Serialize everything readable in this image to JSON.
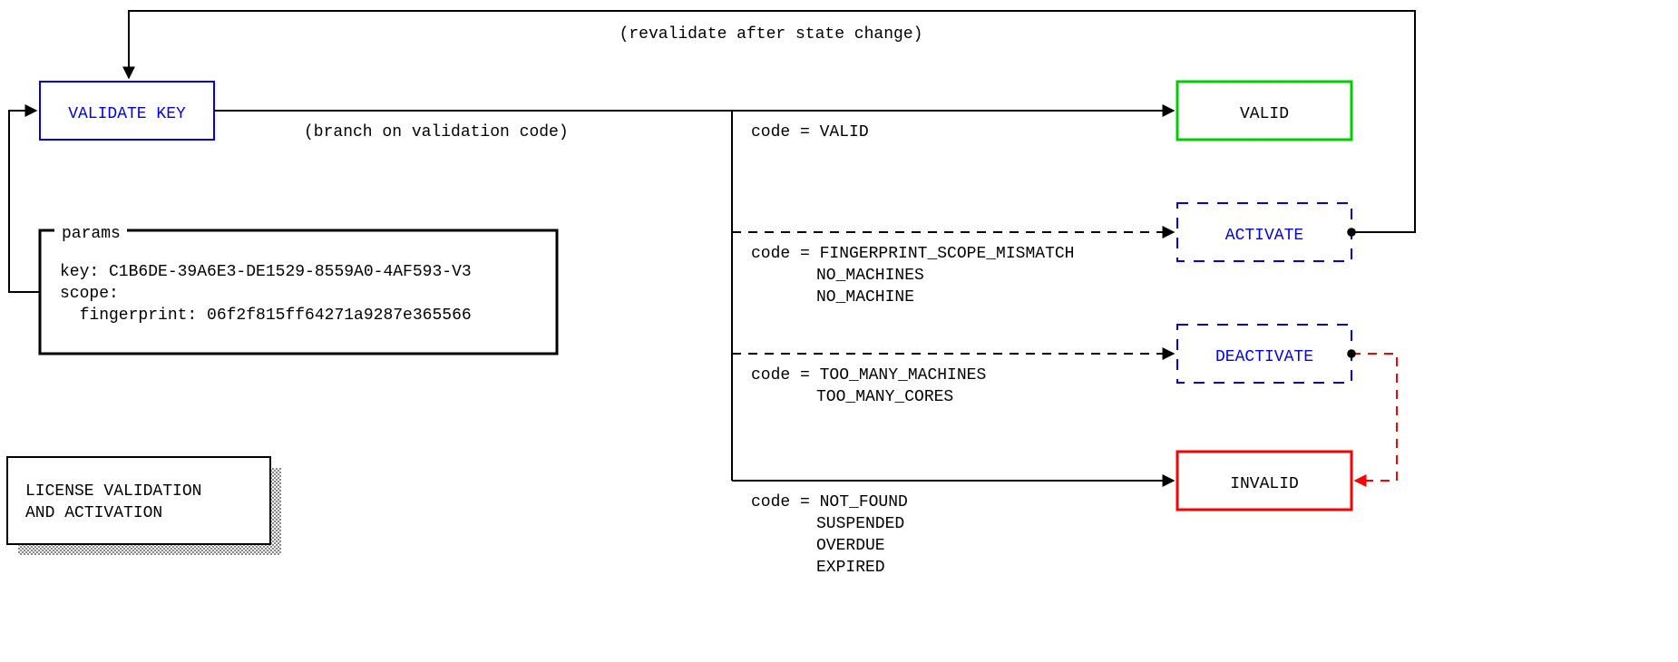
{
  "title": {
    "line1": "LICENSE VALIDATION",
    "line2": "AND ACTIVATION"
  },
  "validate_key": "VALIDATE KEY",
  "params": {
    "legend": "params",
    "key_line": "key: C1B6DE-39A6E3-DE1529-8559A0-4AF593-V3",
    "scope_line": "scope:",
    "fingerprint_line": "  fingerprint: 06f2f815ff64271a9287e365566"
  },
  "edge_labels": {
    "revalidate": "(revalidate after state change)",
    "branch": "(branch on validation code)"
  },
  "branches": {
    "valid": {
      "code_label": "code = VALID",
      "box": "VALID"
    },
    "activate": {
      "code_prefix": "code = ",
      "codes": [
        "FINGERPRINT_SCOPE_MISMATCH",
        "NO_MACHINES",
        "NO_MACHINE"
      ],
      "box": "ACTIVATE"
    },
    "deactivate": {
      "code_prefix": "code = ",
      "codes": [
        "TOO_MANY_MACHINES",
        "TOO_MANY_CORES"
      ],
      "box": "DEACTIVATE"
    },
    "invalid": {
      "code_prefix": "code = ",
      "codes": [
        "NOT_FOUND",
        "SUSPENDED",
        "OVERDUE",
        "EXPIRED"
      ],
      "box": "INVALID"
    }
  }
}
